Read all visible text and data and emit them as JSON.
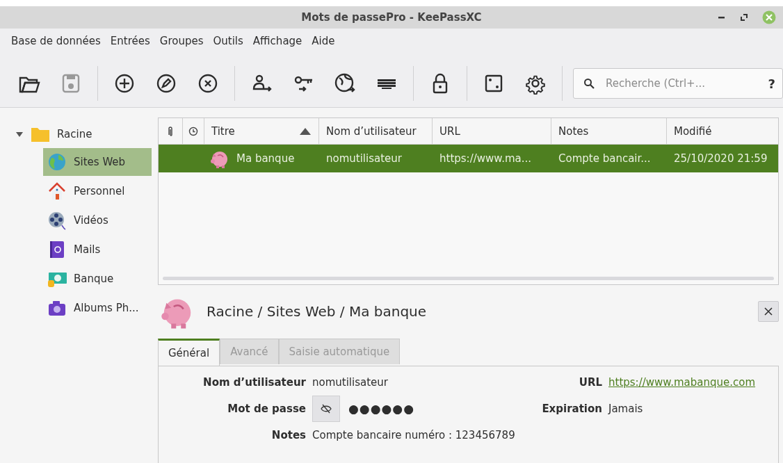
{
  "window": {
    "title": "Mots de passePro - KeePassXC"
  },
  "menu": [
    "Base de données",
    "Entrées",
    "Groupes",
    "Outils",
    "Affichage",
    "Aide"
  ],
  "toolbar": {
    "groups": [
      [
        {
          "kind": "open",
          "disabled": false
        },
        {
          "kind": "save",
          "disabled": true
        }
      ],
      [
        {
          "kind": "add",
          "disabled": false
        },
        {
          "kind": "edit",
          "disabled": false
        },
        {
          "kind": "delete",
          "disabled": false
        }
      ],
      [
        {
          "kind": "user",
          "disabled": false
        },
        {
          "kind": "key",
          "disabled": false
        },
        {
          "kind": "globe",
          "disabled": false
        },
        {
          "kind": "keyboard",
          "disabled": false
        }
      ],
      [
        {
          "kind": "lock",
          "disabled": false
        }
      ],
      [
        {
          "kind": "dice",
          "disabled": false
        },
        {
          "kind": "gear",
          "disabled": false
        }
      ]
    ],
    "search": {
      "placeholder": "Recherche (Ctrl+...",
      "help": "?"
    }
  },
  "groups": {
    "label": "Racine",
    "expanded": true,
    "selected": false,
    "children": [
      {
        "label": "Sites Web",
        "kind": "globe",
        "selected": true
      },
      {
        "label": "Personnel",
        "kind": "house",
        "selected": false
      },
      {
        "label": "Vidéos",
        "kind": "film",
        "selected": false
      },
      {
        "label": "Mails",
        "kind": "mail",
        "selected": false
      },
      {
        "label": "Banque",
        "kind": "money",
        "selected": false
      },
      {
        "label": "Albums Ph...",
        "kind": "camera",
        "selected": false
      }
    ]
  },
  "table": {
    "columns": [
      {
        "kind": "attachment"
      },
      {
        "kind": "clock"
      },
      {
        "kind": "text",
        "label": "Titre",
        "sort_ascending": true
      },
      {
        "kind": "text",
        "label": "Nom d’utilisateur"
      },
      {
        "kind": "text",
        "label": "URL"
      },
      {
        "kind": "text",
        "label": "Notes"
      },
      {
        "kind": "text",
        "label": "Modifié"
      }
    ],
    "rows": [
      {
        "selected": true,
        "title": "Ma banque",
        "username": "nomutilisateur",
        "url": "https://www.ma...",
        "notes": "Compte bancair...",
        "modified": "25/10/2020 21:59"
      }
    ]
  },
  "detail": {
    "breadcrumb": "Racine / Sites Web / Ma banque",
    "tabs": [
      {
        "label": "Général",
        "selected": true
      },
      {
        "label": "Avancé",
        "selected": false
      },
      {
        "label": "Saisie automatique",
        "selected": false
      }
    ],
    "username": {
      "label": "Nom d’utilisateur",
      "value": "nomutilisateur"
    },
    "url": {
      "label": "URL",
      "value": "https://www.mabanque.com"
    },
    "password": {
      "label": "Mot de passe",
      "value": "●●●●●●"
    },
    "expiration": {
      "label": "Expiration",
      "value": "Jamais"
    },
    "notes": {
      "label": "Notes",
      "value": "Compte bancaire numéro : 123456789"
    }
  }
}
